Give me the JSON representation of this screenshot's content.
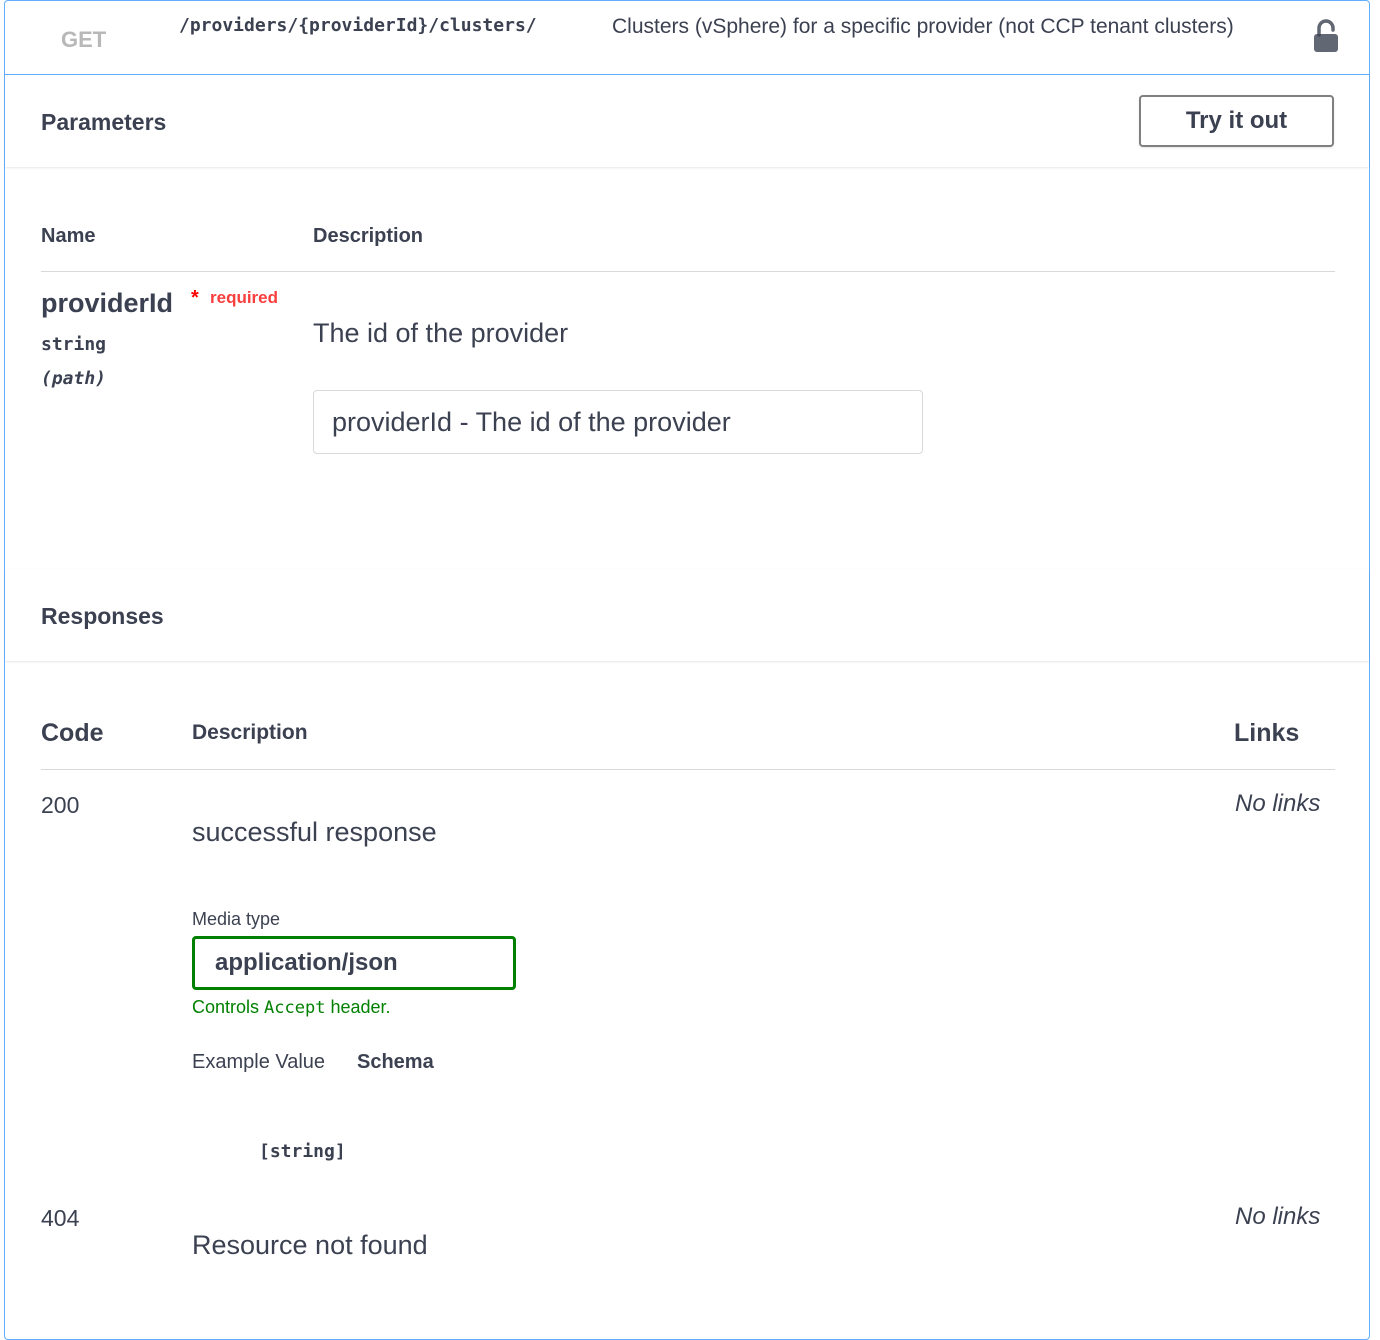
{
  "operation": {
    "method": "GET",
    "path": "/providers/{providerId}/clusters/",
    "summary": "Clusters (vSphere) for a specific provider (not CCP tenant clusters)",
    "lock_icon": "lock-open-icon"
  },
  "parameters": {
    "section_title": "Parameters",
    "try_button_label": "Try it out",
    "col_name": "Name",
    "col_description": "Description",
    "items": [
      {
        "name": "providerId",
        "required_star": "*",
        "required_label": "required",
        "type": "string",
        "in": "(path)",
        "description": "The id of the provider",
        "placeholder": "providerId - The id of the provider"
      }
    ]
  },
  "responses": {
    "section_title": "Responses",
    "col_code": "Code",
    "col_description": "Description",
    "col_links": "Links",
    "items": [
      {
        "code": "200",
        "description": "successful response",
        "links": "No links",
        "media_type_label": "Media type",
        "media_type": "application/json",
        "controls_prefix": "Controls",
        "controls_code": "Accept",
        "controls_suffix": "header.",
        "example_tab": "Example Value",
        "schema_tab": "Schema",
        "schema": "[string]"
      },
      {
        "code": "404",
        "description": "Resource not found",
        "links": "No links"
      }
    ]
  },
  "colors": {
    "get_border": "#61affe",
    "required": "#ff0000",
    "media_border": "#008000"
  }
}
